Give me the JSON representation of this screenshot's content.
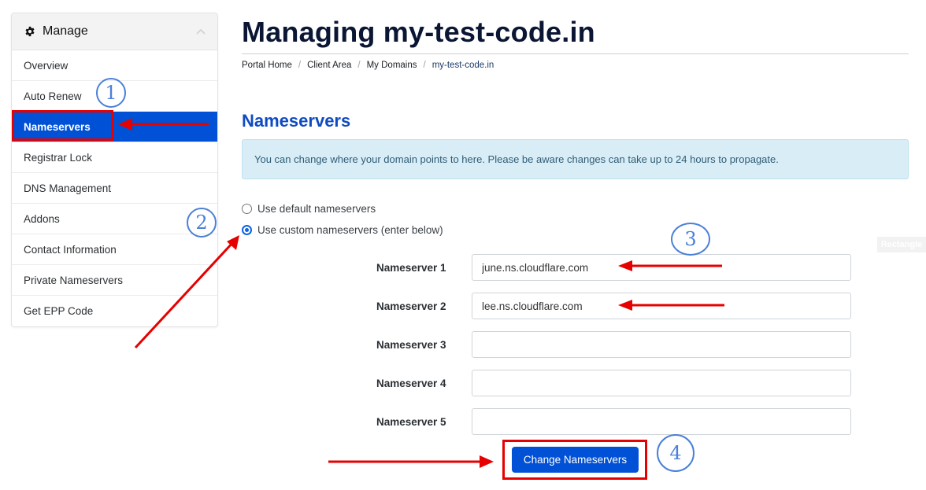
{
  "sidebar": {
    "header": {
      "icon": "gear-icon",
      "title": "Manage",
      "collapse_icon": "chevron-up-icon"
    },
    "items": [
      {
        "label": "Overview",
        "active": false
      },
      {
        "label": "Auto Renew",
        "active": false
      },
      {
        "label": "Nameservers",
        "active": true
      },
      {
        "label": "Registrar Lock",
        "active": false
      },
      {
        "label": "DNS Management",
        "active": false
      },
      {
        "label": "Addons",
        "active": false
      },
      {
        "label": "Contact Information",
        "active": false
      },
      {
        "label": "Private Nameservers",
        "active": false
      },
      {
        "label": "Get EPP Code",
        "active": false
      }
    ]
  },
  "header": {
    "title": "Managing my-test-code.in",
    "breadcrumb": [
      {
        "label": "Portal Home"
      },
      {
        "label": "Client Area"
      },
      {
        "label": "My Domains"
      },
      {
        "label": "my-test-code.in"
      }
    ],
    "breadcrumb_separator": "/"
  },
  "nameservers": {
    "section_title": "Nameservers",
    "info": "You can change where your domain points to here. Please be aware changes can take up to 24 hours to propagate.",
    "options": [
      {
        "label": "Use default nameservers",
        "checked": false
      },
      {
        "label": "Use custom nameservers (enter below)",
        "checked": true
      }
    ],
    "fields": [
      {
        "label": "Nameserver 1",
        "value": "june.ns.cloudflare.com"
      },
      {
        "label": "Nameserver 2",
        "value": "lee.ns.cloudflare.com"
      },
      {
        "label": "Nameserver 3",
        "value": ""
      },
      {
        "label": "Nameserver 4",
        "value": ""
      },
      {
        "label": "Nameserver 5",
        "value": ""
      }
    ],
    "submit_label": "Change Nameservers"
  },
  "annotations": {
    "steps": [
      "1",
      "2",
      "3",
      "4"
    ],
    "leftover_tag": "Rectangle",
    "annotation_color": "#e60000",
    "step_circle_color": "#4a80d8"
  },
  "colors": {
    "primary": "#0051d6",
    "heading": "#0a1633",
    "section_title": "#0e4bc3",
    "info_bg": "#d9edf7"
  }
}
